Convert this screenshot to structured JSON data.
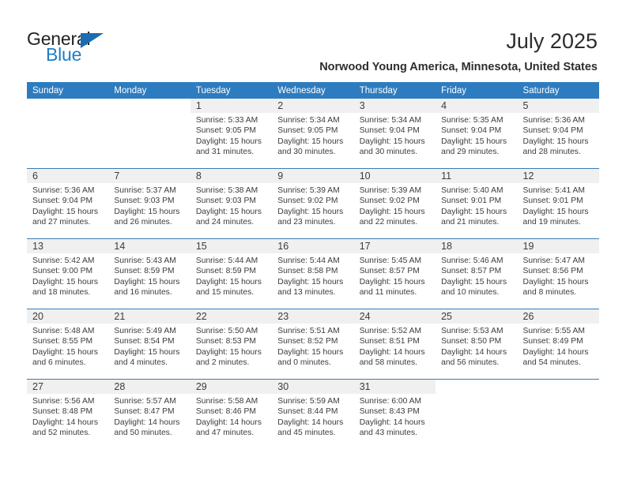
{
  "brand": {
    "word_one": "General",
    "word_two": "Blue",
    "triangle_icon": "triangle-icon",
    "colors": {
      "dark": "#231f20",
      "blue": "#1f7ec4",
      "triangle": "#1b6cb0"
    }
  },
  "header": {
    "title": "July 2025",
    "subtitle": "Norwood Young America, Minnesota, United States"
  },
  "calendar": {
    "accent_header_color": "#2e7cc0",
    "daynum_band_color": "#f0f0f0",
    "row_divider_color": "#3a7cb5",
    "weekday_headers": [
      "Sunday",
      "Monday",
      "Tuesday",
      "Wednesday",
      "Thursday",
      "Friday",
      "Saturday"
    ],
    "weeks": [
      [
        {
          "blank": true
        },
        {
          "blank": true
        },
        {
          "day": "1",
          "sunrise": "Sunrise: 5:33 AM",
          "sunset": "Sunset: 9:05 PM",
          "daylight_line1": "Daylight: 15 hours",
          "daylight_line2": "and 31 minutes."
        },
        {
          "day": "2",
          "sunrise": "Sunrise: 5:34 AM",
          "sunset": "Sunset: 9:05 PM",
          "daylight_line1": "Daylight: 15 hours",
          "daylight_line2": "and 30 minutes."
        },
        {
          "day": "3",
          "sunrise": "Sunrise: 5:34 AM",
          "sunset": "Sunset: 9:04 PM",
          "daylight_line1": "Daylight: 15 hours",
          "daylight_line2": "and 30 minutes."
        },
        {
          "day": "4",
          "sunrise": "Sunrise: 5:35 AM",
          "sunset": "Sunset: 9:04 PM",
          "daylight_line1": "Daylight: 15 hours",
          "daylight_line2": "and 29 minutes."
        },
        {
          "day": "5",
          "sunrise": "Sunrise: 5:36 AM",
          "sunset": "Sunset: 9:04 PM",
          "daylight_line1": "Daylight: 15 hours",
          "daylight_line2": "and 28 minutes."
        }
      ],
      [
        {
          "day": "6",
          "sunrise": "Sunrise: 5:36 AM",
          "sunset": "Sunset: 9:04 PM",
          "daylight_line1": "Daylight: 15 hours",
          "daylight_line2": "and 27 minutes."
        },
        {
          "day": "7",
          "sunrise": "Sunrise: 5:37 AM",
          "sunset": "Sunset: 9:03 PM",
          "daylight_line1": "Daylight: 15 hours",
          "daylight_line2": "and 26 minutes."
        },
        {
          "day": "8",
          "sunrise": "Sunrise: 5:38 AM",
          "sunset": "Sunset: 9:03 PM",
          "daylight_line1": "Daylight: 15 hours",
          "daylight_line2": "and 24 minutes."
        },
        {
          "day": "9",
          "sunrise": "Sunrise: 5:39 AM",
          "sunset": "Sunset: 9:02 PM",
          "daylight_line1": "Daylight: 15 hours",
          "daylight_line2": "and 23 minutes."
        },
        {
          "day": "10",
          "sunrise": "Sunrise: 5:39 AM",
          "sunset": "Sunset: 9:02 PM",
          "daylight_line1": "Daylight: 15 hours",
          "daylight_line2": "and 22 minutes."
        },
        {
          "day": "11",
          "sunrise": "Sunrise: 5:40 AM",
          "sunset": "Sunset: 9:01 PM",
          "daylight_line1": "Daylight: 15 hours",
          "daylight_line2": "and 21 minutes."
        },
        {
          "day": "12",
          "sunrise": "Sunrise: 5:41 AM",
          "sunset": "Sunset: 9:01 PM",
          "daylight_line1": "Daylight: 15 hours",
          "daylight_line2": "and 19 minutes."
        }
      ],
      [
        {
          "day": "13",
          "sunrise": "Sunrise: 5:42 AM",
          "sunset": "Sunset: 9:00 PM",
          "daylight_line1": "Daylight: 15 hours",
          "daylight_line2": "and 18 minutes."
        },
        {
          "day": "14",
          "sunrise": "Sunrise: 5:43 AM",
          "sunset": "Sunset: 8:59 PM",
          "daylight_line1": "Daylight: 15 hours",
          "daylight_line2": "and 16 minutes."
        },
        {
          "day": "15",
          "sunrise": "Sunrise: 5:44 AM",
          "sunset": "Sunset: 8:59 PM",
          "daylight_line1": "Daylight: 15 hours",
          "daylight_line2": "and 15 minutes."
        },
        {
          "day": "16",
          "sunrise": "Sunrise: 5:44 AM",
          "sunset": "Sunset: 8:58 PM",
          "daylight_line1": "Daylight: 15 hours",
          "daylight_line2": "and 13 minutes."
        },
        {
          "day": "17",
          "sunrise": "Sunrise: 5:45 AM",
          "sunset": "Sunset: 8:57 PM",
          "daylight_line1": "Daylight: 15 hours",
          "daylight_line2": "and 11 minutes."
        },
        {
          "day": "18",
          "sunrise": "Sunrise: 5:46 AM",
          "sunset": "Sunset: 8:57 PM",
          "daylight_line1": "Daylight: 15 hours",
          "daylight_line2": "and 10 minutes."
        },
        {
          "day": "19",
          "sunrise": "Sunrise: 5:47 AM",
          "sunset": "Sunset: 8:56 PM",
          "daylight_line1": "Daylight: 15 hours",
          "daylight_line2": "and 8 minutes."
        }
      ],
      [
        {
          "day": "20",
          "sunrise": "Sunrise: 5:48 AM",
          "sunset": "Sunset: 8:55 PM",
          "daylight_line1": "Daylight: 15 hours",
          "daylight_line2": "and 6 minutes."
        },
        {
          "day": "21",
          "sunrise": "Sunrise: 5:49 AM",
          "sunset": "Sunset: 8:54 PM",
          "daylight_line1": "Daylight: 15 hours",
          "daylight_line2": "and 4 minutes."
        },
        {
          "day": "22",
          "sunrise": "Sunrise: 5:50 AM",
          "sunset": "Sunset: 8:53 PM",
          "daylight_line1": "Daylight: 15 hours",
          "daylight_line2": "and 2 minutes."
        },
        {
          "day": "23",
          "sunrise": "Sunrise: 5:51 AM",
          "sunset": "Sunset: 8:52 PM",
          "daylight_line1": "Daylight: 15 hours",
          "daylight_line2": "and 0 minutes."
        },
        {
          "day": "24",
          "sunrise": "Sunrise: 5:52 AM",
          "sunset": "Sunset: 8:51 PM",
          "daylight_line1": "Daylight: 14 hours",
          "daylight_line2": "and 58 minutes."
        },
        {
          "day": "25",
          "sunrise": "Sunrise: 5:53 AM",
          "sunset": "Sunset: 8:50 PM",
          "daylight_line1": "Daylight: 14 hours",
          "daylight_line2": "and 56 minutes."
        },
        {
          "day": "26",
          "sunrise": "Sunrise: 5:55 AM",
          "sunset": "Sunset: 8:49 PM",
          "daylight_line1": "Daylight: 14 hours",
          "daylight_line2": "and 54 minutes."
        }
      ],
      [
        {
          "day": "27",
          "sunrise": "Sunrise: 5:56 AM",
          "sunset": "Sunset: 8:48 PM",
          "daylight_line1": "Daylight: 14 hours",
          "daylight_line2": "and 52 minutes."
        },
        {
          "day": "28",
          "sunrise": "Sunrise: 5:57 AM",
          "sunset": "Sunset: 8:47 PM",
          "daylight_line1": "Daylight: 14 hours",
          "daylight_line2": "and 50 minutes."
        },
        {
          "day": "29",
          "sunrise": "Sunrise: 5:58 AM",
          "sunset": "Sunset: 8:46 PM",
          "daylight_line1": "Daylight: 14 hours",
          "daylight_line2": "and 47 minutes."
        },
        {
          "day": "30",
          "sunrise": "Sunrise: 5:59 AM",
          "sunset": "Sunset: 8:44 PM",
          "daylight_line1": "Daylight: 14 hours",
          "daylight_line2": "and 45 minutes."
        },
        {
          "day": "31",
          "sunrise": "Sunrise: 6:00 AM",
          "sunset": "Sunset: 8:43 PM",
          "daylight_line1": "Daylight: 14 hours",
          "daylight_line2": "and 43 minutes."
        },
        {
          "blank": true
        },
        {
          "blank": true
        }
      ]
    ]
  }
}
